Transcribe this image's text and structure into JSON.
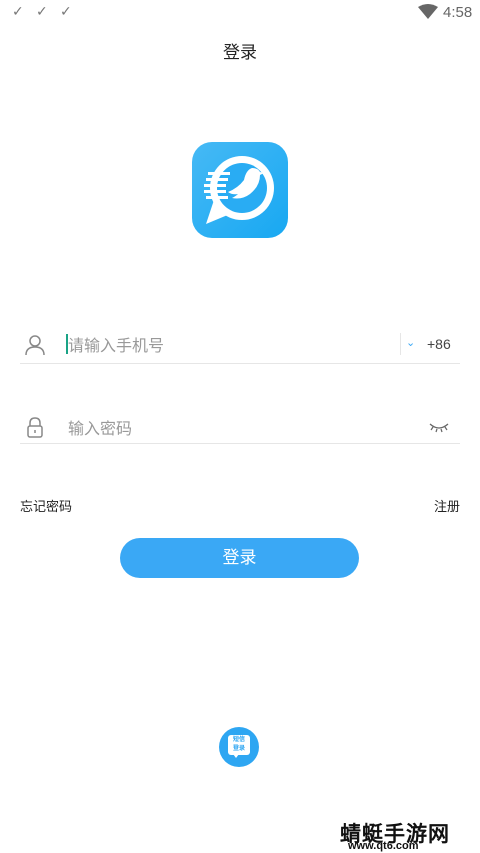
{
  "status_bar": {
    "time": "4:58",
    "notification_icons": [
      "check-icon",
      "check-icon",
      "check-icon"
    ],
    "wifi_icon": "wifi-icon"
  },
  "header": {
    "title": "登录"
  },
  "logo": {
    "icon": "app-logo-icon",
    "color": "#1aa8f2"
  },
  "phone_field": {
    "placeholder": "请输入手机号",
    "value": "",
    "icon": "user-icon",
    "country_code": "+86",
    "dropdown_icon": "chevron-down-icon"
  },
  "password_field": {
    "placeholder": "输入密码",
    "value": "",
    "icon": "lock-icon",
    "toggle_icon": "eye-closed-icon"
  },
  "links": {
    "forgot_password": "忘记密码",
    "register": "注册"
  },
  "login_button": {
    "label": "登录",
    "color": "#3aa8f5"
  },
  "sms_login": {
    "line1": "短信",
    "line2": "登录"
  },
  "watermark": {
    "text": "蜻蜓手游网",
    "url": "www.qt6.com"
  }
}
